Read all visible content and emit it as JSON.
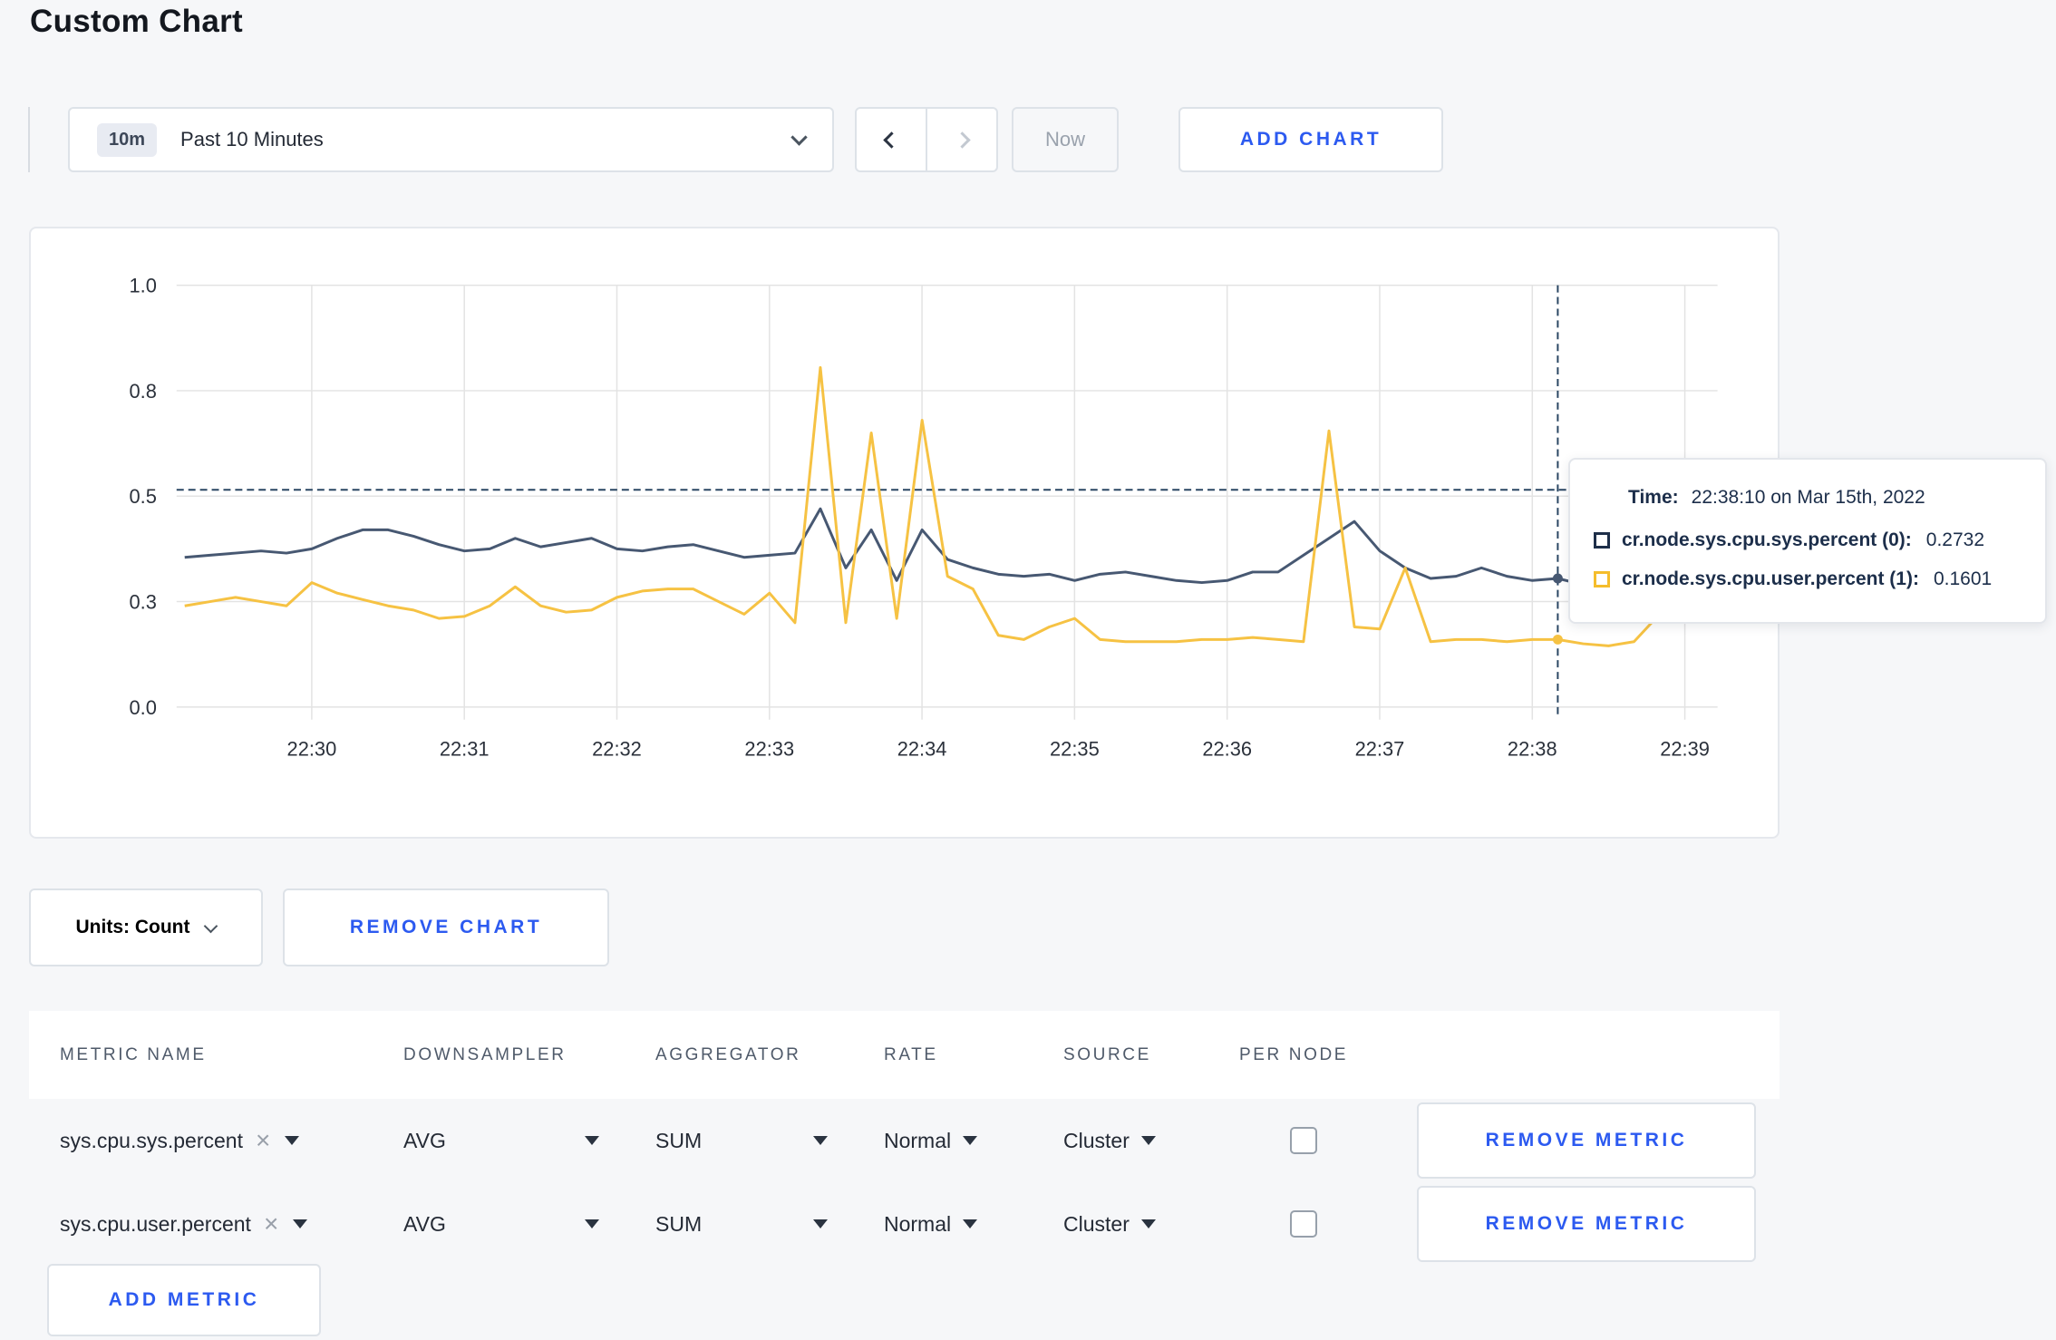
{
  "page": {
    "title": "Custom Chart"
  },
  "toolbar": {
    "time_badge": "10m",
    "time_label": "Past 10 Minutes",
    "now_label": "Now",
    "add_chart_label": "ADD CHART"
  },
  "chart_data": {
    "type": "line",
    "title": "",
    "xlabel": "",
    "ylabel": "",
    "ylim": [
      0,
      1
    ],
    "grid": true,
    "x_start": "22:29:10",
    "x_interval_seconds": 10,
    "x_ticks": [
      "22:30",
      "22:31",
      "22:32",
      "22:33",
      "22:34",
      "22:35",
      "22:36",
      "22:37",
      "22:38",
      "22:39"
    ],
    "y_ticks": [
      {
        "value": 0,
        "label": "0.0"
      },
      {
        "value": 0.25,
        "label": "0.3"
      },
      {
        "value": 0.5,
        "label": "0.5"
      },
      {
        "value": 0.75,
        "label": "0.8"
      },
      {
        "value": 1,
        "label": "1.0"
      }
    ],
    "series": [
      {
        "name": "cr.node.sys.cpu.sys.percent (0)",
        "color": "#475872",
        "values": [
          0.355,
          0.36,
          0.365,
          0.37,
          0.365,
          0.375,
          0.4,
          0.42,
          0.42,
          0.405,
          0.385,
          0.37,
          0.375,
          0.4,
          0.38,
          0.39,
          0.4,
          0.375,
          0.37,
          0.38,
          0.385,
          0.37,
          0.355,
          0.36,
          0.365,
          0.47,
          0.33,
          0.42,
          0.3,
          0.42,
          0.35,
          0.33,
          0.315,
          0.31,
          0.315,
          0.3,
          0.315,
          0.32,
          0.31,
          0.3,
          0.295,
          0.3,
          0.32,
          0.32,
          0.36,
          0.4,
          0.44,
          0.37,
          0.33,
          0.305,
          0.31,
          0.33,
          0.31,
          0.3,
          0.305,
          0.29,
          0.285,
          0.28,
          0.285,
          0.295,
          0.31
        ]
      },
      {
        "name": "cr.node.sys.cpu.user.percent (1)",
        "color": "#f6c243",
        "values": [
          0.24,
          0.25,
          0.26,
          0.25,
          0.24,
          0.295,
          0.27,
          0.255,
          0.24,
          0.23,
          0.21,
          0.215,
          0.24,
          0.285,
          0.24,
          0.225,
          0.23,
          0.26,
          0.275,
          0.28,
          0.28,
          0.25,
          0.22,
          0.27,
          0.2,
          0.805,
          0.2,
          0.65,
          0.21,
          0.68,
          0.31,
          0.28,
          0.17,
          0.16,
          0.19,
          0.21,
          0.16,
          0.155,
          0.155,
          0.155,
          0.16,
          0.16,
          0.165,
          0.16,
          0.155,
          0.655,
          0.19,
          0.185,
          0.33,
          0.155,
          0.16,
          0.16,
          0.155,
          0.16,
          0.16,
          0.15,
          0.145,
          0.155,
          0.22,
          0.295,
          0.24
        ]
      }
    ],
    "crosshair": {
      "time": "22:38:10",
      "t_seconds": 540,
      "index": 54,
      "hline_value": 0.515,
      "color": "#2a4663"
    },
    "legend_position": "tooltip"
  },
  "tooltip": {
    "time_label": "Time:",
    "time_value": "22:38:10 on Mar 15th, 2022",
    "series": [
      {
        "name": "cr.node.sys.cpu.sys.percent (0):",
        "value": "0.2732",
        "color": "#1e2f49"
      },
      {
        "name": "cr.node.sys.cpu.user.percent (1):",
        "value": "0.1601",
        "color": "#f5bd2c"
      }
    ]
  },
  "chart_controls": {
    "units_label": "Units: Count",
    "remove_chart_label": "REMOVE CHART"
  },
  "metrics_table": {
    "headers": [
      "METRIC NAME",
      "DOWNSAMPLER",
      "AGGREGATOR",
      "RATE",
      "SOURCE",
      "PER NODE"
    ],
    "rows": [
      {
        "metric": "sys.cpu.sys.percent",
        "remove_icon": "×",
        "downsampler": "AVG",
        "aggregator": "SUM",
        "rate": "Normal",
        "source": "Cluster",
        "per_node_checked": false,
        "remove_label": "REMOVE METRIC"
      },
      {
        "metric": "sys.cpu.user.percent",
        "remove_icon": "×",
        "downsampler": "AVG",
        "aggregator": "SUM",
        "rate": "Normal",
        "source": "Cluster",
        "per_node_checked": false,
        "remove_label": "REMOVE METRIC"
      }
    ],
    "add_metric_label": "ADD METRIC"
  }
}
